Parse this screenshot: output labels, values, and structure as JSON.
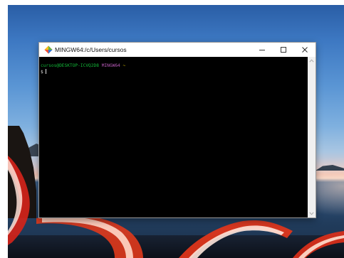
{
  "window": {
    "title": "MINGW64:/c/Users/cursos",
    "controls": {
      "minimize": "minimize",
      "maximize": "maximize",
      "close": "close"
    }
  },
  "terminal": {
    "prompt_user_host": "cursos@DESKTOP-ICVQ2D8",
    "prompt_shell": "MINGW64",
    "prompt_path": "~",
    "prompt_symbol": "$"
  },
  "icons": {
    "app": "git-bash-icon",
    "minimize": "minimize-icon",
    "maximize": "maximize-icon",
    "close": "close-icon",
    "scroll_up": "chevron-up-icon",
    "scroll_down": "chevron-down-icon"
  },
  "colors": {
    "prompt_user_host": "#12b838",
    "prompt_shell": "#b85ab8",
    "prompt_path": "#d8c000",
    "terminal_bg": "#000000",
    "titlebar_bg": "#ffffff"
  }
}
